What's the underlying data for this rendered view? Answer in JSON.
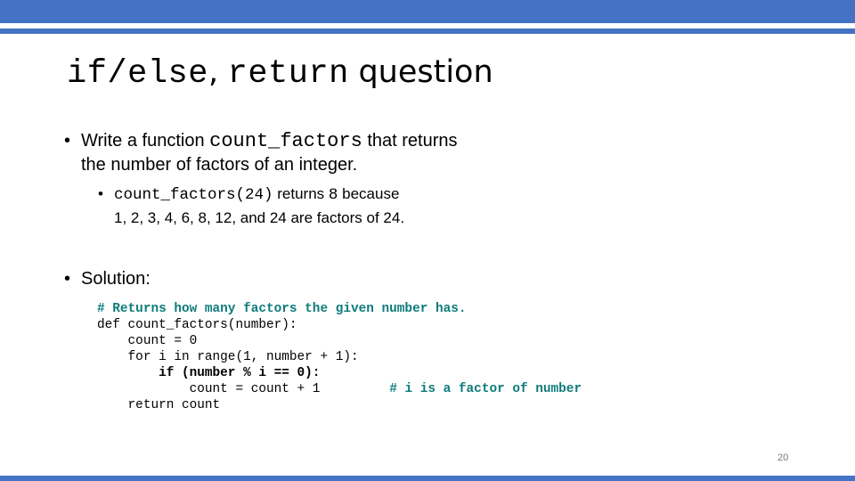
{
  "colors": {
    "accent_bar": "#4472c4",
    "code_comment": "#0f7b7b",
    "page_number": "#777777"
  },
  "title": {
    "code_part": "if/else, return",
    "code_part_1": "if/else",
    "separator": ",",
    "code_part_2": "return",
    "text_part": "question"
  },
  "bullets": [
    {
      "text_before": "Write a function ",
      "code": "count_factors",
      "text_after": " that returns",
      "line2": "the number of factors of an integer."
    },
    {
      "code": "count_factors(24)",
      "text_after": " returns ",
      "value": "8",
      "text_after2": " because",
      "line2": "1, 2, 3, 4, 6, 8, 12, and 24 are factors of 24."
    },
    {
      "text": "Solution:"
    }
  ],
  "code": {
    "lines": [
      {
        "text": "# Returns how many factors the given number has."
      },
      {
        "text": "def count_factors(number):"
      },
      {
        "text": "    count = 0"
      },
      {
        "text": "    for i in range(1, number + 1):"
      },
      {
        "text": "        if (number % i == 0):"
      },
      {
        "text": "            count = count + 1",
        "comment": "# i is a factor of number"
      },
      {
        "text": "    return count"
      }
    ],
    "line6_pad": "        "
  },
  "bullet_glyph": "•",
  "page_number": "20"
}
